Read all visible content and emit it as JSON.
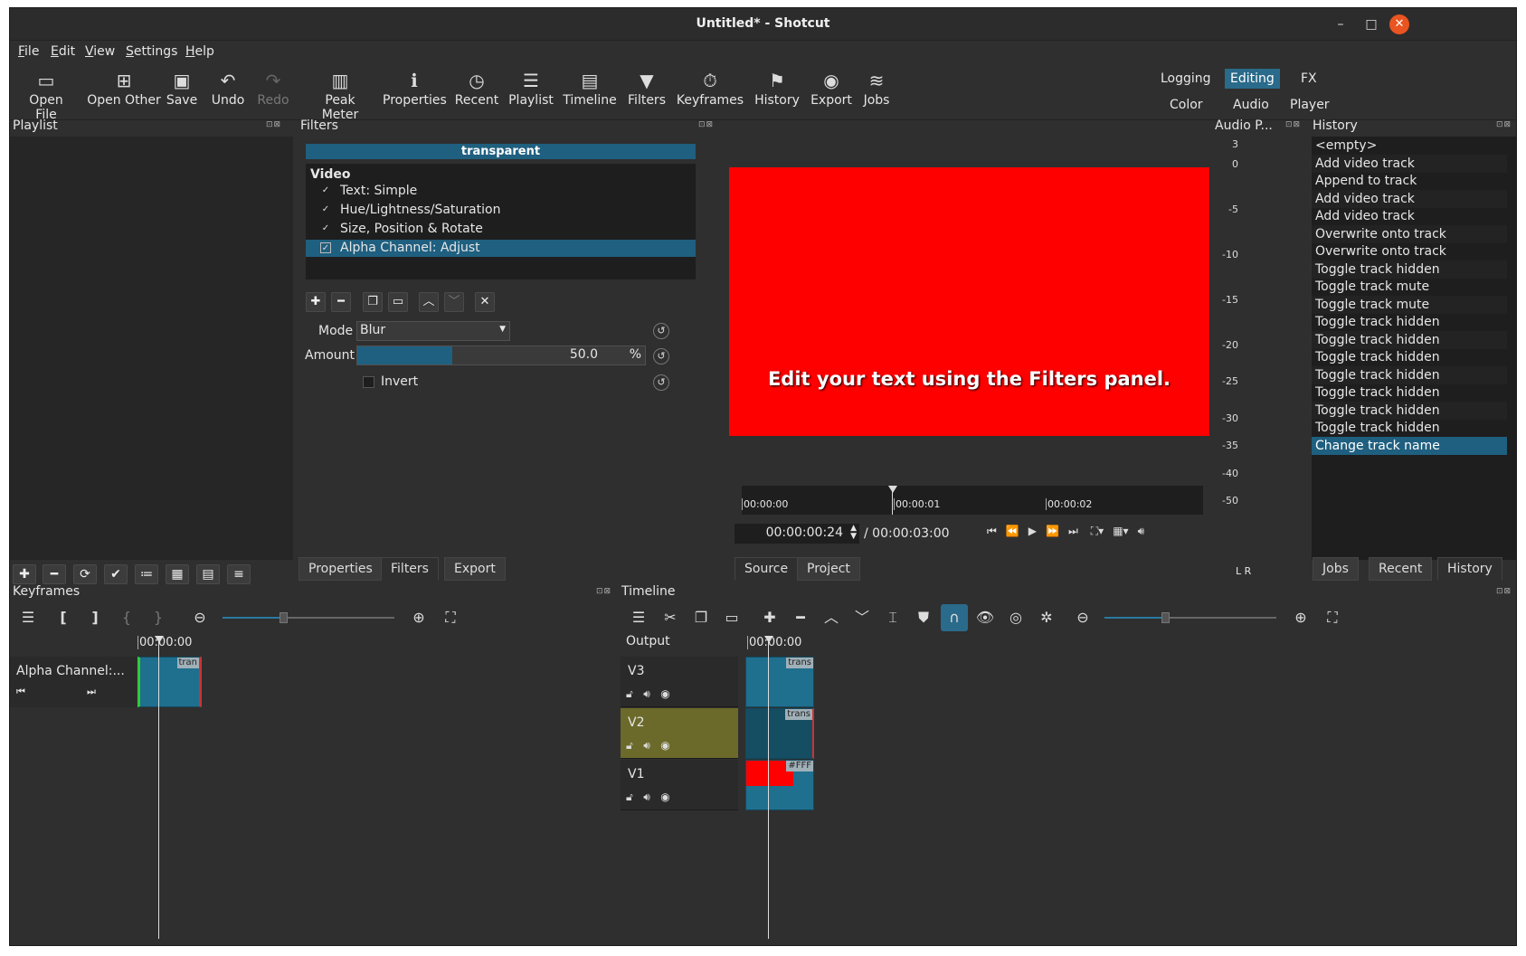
{
  "window": {
    "title": "Untitled* - Shotcut",
    "minimize": "–",
    "maximize": "□",
    "close": "✕"
  },
  "menu": [
    "File",
    "Edit",
    "View",
    "Settings",
    "Help"
  ],
  "toolbar": [
    {
      "label": "Open File",
      "icon": "folder-open-icon"
    },
    {
      "label": "Open Other",
      "icon": "open-other-icon"
    },
    {
      "label": "Save",
      "icon": "save-icon"
    },
    {
      "label": "Undo",
      "icon": "undo-icon"
    },
    {
      "label": "Redo",
      "icon": "redo-icon",
      "disabled": true
    },
    {
      "label": "Peak Meter",
      "icon": "peak-meter-icon"
    },
    {
      "label": "Properties",
      "icon": "info-icon"
    },
    {
      "label": "Recent",
      "icon": "clock-icon"
    },
    {
      "label": "Playlist",
      "icon": "list-icon"
    },
    {
      "label": "Timeline",
      "icon": "timeline-icon"
    },
    {
      "label": "Filters",
      "icon": "funnel-icon"
    },
    {
      "label": "Keyframes",
      "icon": "stopwatch-icon"
    },
    {
      "label": "History",
      "icon": "history-icon"
    },
    {
      "label": "Export",
      "icon": "export-icon"
    },
    {
      "label": "Jobs",
      "icon": "jobs-icon"
    }
  ],
  "layouts": {
    "logging": "Logging",
    "editing": "Editing",
    "fx": "FX",
    "color": "Color",
    "audio": "Audio",
    "player": "Player",
    "active": "Editing"
  },
  "playlist": {
    "title": "Playlist"
  },
  "filters": {
    "title": "Filters",
    "selected_clip": "transparent",
    "section": "Video",
    "items": [
      {
        "label": "Text: Simple",
        "checked": true
      },
      {
        "label": "Hue/Lightness/Saturation",
        "checked": true
      },
      {
        "label": "Size, Position & Rotate",
        "checked": true
      },
      {
        "label": "Alpha Channel: Adjust",
        "checked": true,
        "selected": true
      }
    ],
    "mode_label": "Mode",
    "mode_value": "Blur",
    "amount_label": "Amount",
    "amount_value": "50.0",
    "amount_unit": "%",
    "amount_fraction": 0.5,
    "invert_label": "Invert"
  },
  "left_tabs": [
    "Properties",
    "Filters",
    "Export"
  ],
  "player": {
    "overlay_text": "Edit your text using the Filters panel.",
    "video_bg": "#ff0000",
    "ruler": [
      "00:00:00",
      "00:00:01",
      "00:00:02"
    ],
    "current_time": "00:00:00:24",
    "total_time": "/ 00:00:03:00",
    "tabs": [
      "Source",
      "Project"
    ]
  },
  "audio": {
    "title": "Audio P...",
    "scale": [
      "3",
      "0",
      "-5",
      "-10",
      "-15",
      "-20",
      "-25",
      "-30",
      "-35",
      "-40",
      "-50"
    ],
    "lr": "L R"
  },
  "history": {
    "title": "History",
    "items": [
      "<empty>",
      "Add video track",
      "Append to track",
      "Add video track",
      "Add video track",
      "Overwrite onto track",
      "Overwrite onto track",
      "Toggle track hidden",
      "Toggle track mute",
      "Toggle track mute",
      "Toggle track hidden",
      "Toggle track hidden",
      "Toggle track hidden",
      "Toggle track hidden",
      "Toggle track hidden",
      "Toggle track hidden",
      "Toggle track hidden",
      "Change track name"
    ],
    "selected_index": 17,
    "tabs": [
      "Jobs",
      "Recent",
      "History"
    ]
  },
  "keyframes": {
    "title": "Keyframes",
    "time": "00:00:00",
    "track_label": "Alpha Channel:...",
    "clip_tag": "tran"
  },
  "timeline": {
    "title": "Timeline",
    "time": "00:00:00",
    "output_label": "Output",
    "tracks": [
      {
        "name": "V3",
        "clip_tag": "trans",
        "highlight": false
      },
      {
        "name": "V2",
        "clip_tag": "trans",
        "highlight": true
      },
      {
        "name": "V1",
        "clip_tag": "#FFF",
        "highlight": false
      }
    ]
  },
  "colors": {
    "accent": "#1f5f7f",
    "selected_track": "#6b6a2a",
    "clip": "#1f6f8f"
  }
}
